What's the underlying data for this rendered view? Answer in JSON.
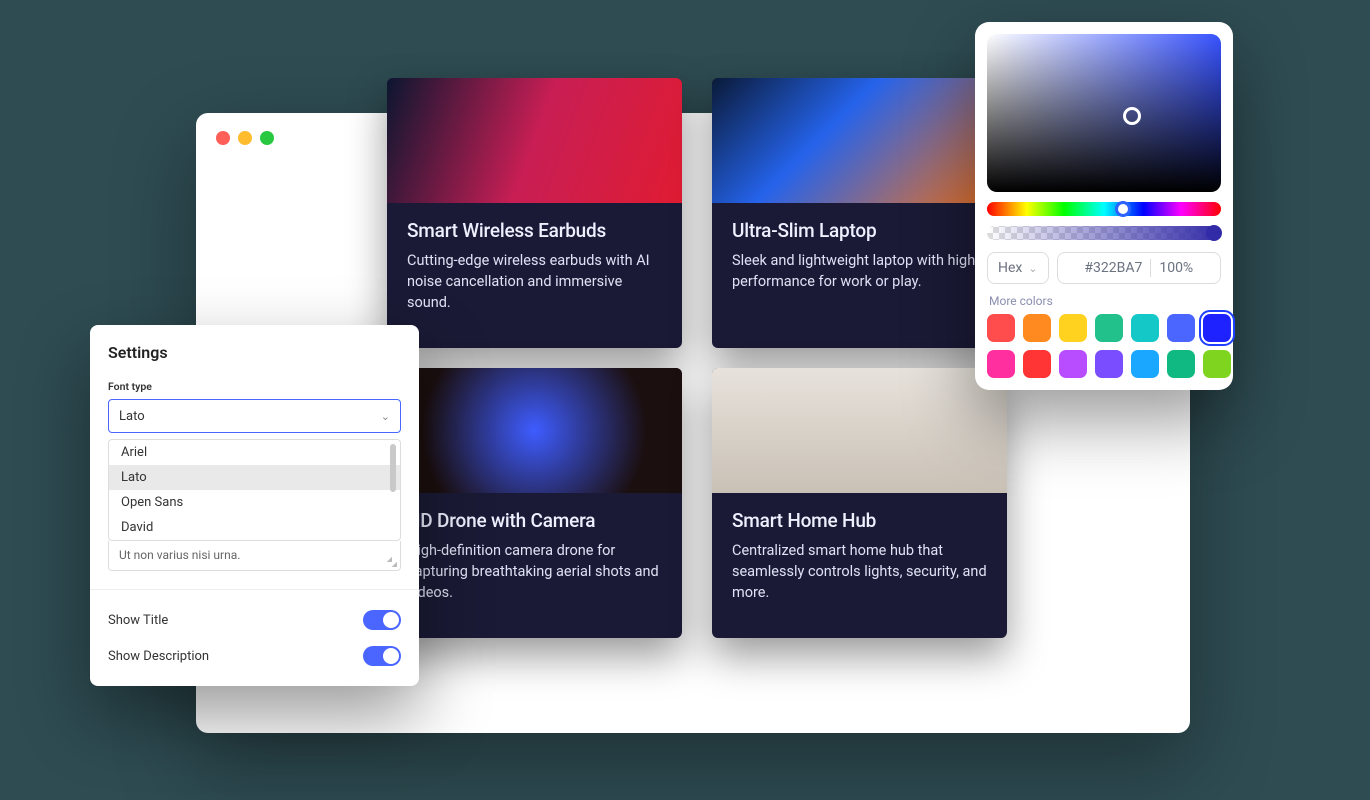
{
  "cards": [
    {
      "title": "Smart Wireless Earbuds",
      "desc": "Cutting-edge wireless earbuds with AI noise cancellation and immersive sound."
    },
    {
      "title": "Ultra-Slim Laptop",
      "desc": "Sleek and lightweight laptop with high performance for work or play."
    },
    {
      "title": "HD Drone with Camera",
      "desc": "High-definition camera drone for capturing breathtaking aerial shots and videos."
    },
    {
      "title": "Smart Home Hub",
      "desc": "Centralized smart home hub that seamlessly controls lights, security, and more."
    }
  ],
  "settings": {
    "title": "Settings",
    "font_type_label": "Font type",
    "selected_font": "Lato",
    "font_options": [
      "Ariel",
      "Lato",
      "Open Sans",
      "David"
    ],
    "textarea_value": "Ut non varius nisi urna.",
    "show_title_label": "Show Title",
    "show_title_on": true,
    "show_desc_label": "Show Description",
    "show_desc_on": true
  },
  "color_picker": {
    "mode_label": "Hex",
    "hex_value": "#322BA7",
    "alpha_value": "100%",
    "more_colors_label": "More colors",
    "swatches": [
      "#ff4d4d",
      "#ff8a1f",
      "#ffd21f",
      "#22c08a",
      "#14c8c8",
      "#4a66ff",
      "#1e22ff",
      "#ff2fa0",
      "#ff3434",
      "#b84dff",
      "#7a4dff",
      "#1aa7ff",
      "#10b981",
      "#7fd41f"
    ],
    "selected_swatch_index": 6
  }
}
